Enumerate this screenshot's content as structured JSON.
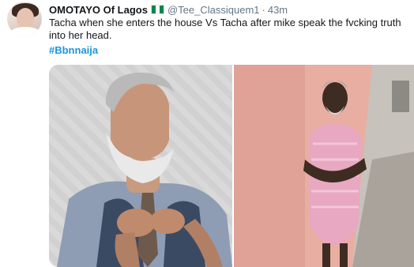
{
  "tweet": {
    "author_name": "OMOTAYO Of Lagos",
    "handle": "@Tee_Classiquem1",
    "separator": "·",
    "time": "43m",
    "text": "Tacha when she enters the house Vs Tacha after mike speak the fvcking truth into her head.",
    "hashtag": "#Bbnnaija"
  },
  "colors": {
    "name": "#14171a",
    "secondary": "#657786",
    "hashtag": "#1b95e0",
    "flag_green": "#008751"
  },
  "icons": {
    "flag": "nigeria-flag-icon"
  },
  "media": {
    "left_photo": "bearded-man-adjusting-tie",
    "right_photo": "elderly-woman-pink-dress-against-wall"
  }
}
